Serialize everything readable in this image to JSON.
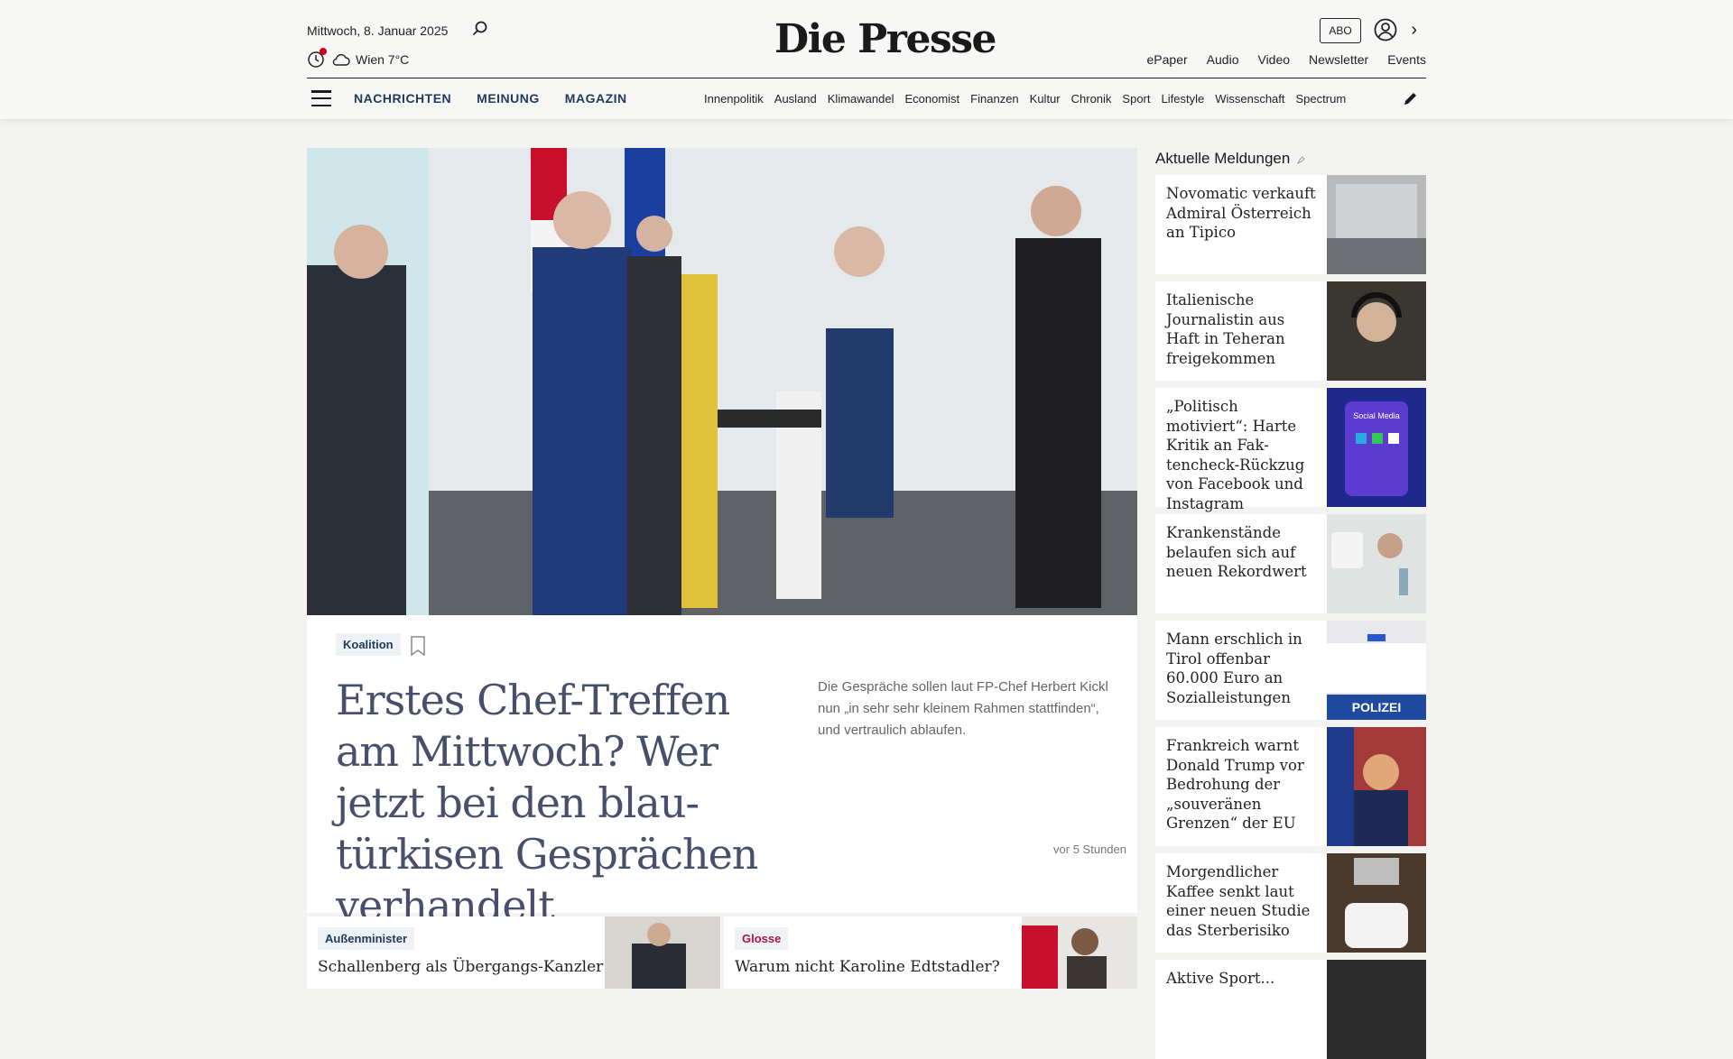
{
  "header": {
    "date": "Mittwoch, 8. Januar 2025",
    "weather": "Wien 7°C",
    "logo": "Die Presse",
    "abo_label": "ABO",
    "top_links": [
      "ePaper",
      "Audio",
      "Video",
      "Newsletter",
      "Events"
    ],
    "main_nav": [
      "NACHRICHTEN",
      "MEINUNG",
      "MAGAZIN"
    ],
    "sub_nav": [
      "Innenpolitik",
      "Ausland",
      "Klimawandel",
      "Economist",
      "Finanzen",
      "Kultur",
      "Chronik",
      "Sport",
      "Lifestyle",
      "Wissenschaft",
      "Spectrum"
    ]
  },
  "hero": {
    "tag": "Koalition",
    "title": "Erstes Chef-Treffen am Mittwoch? Wer jetzt bei den blau-türkisen Gesprächen verhandelt",
    "lead": "Die Gespräche sollen laut FP-Chef Herbert Kickl nun „in sehr sehr kleinem Rahmen stattfinden“, und vertraulich ablaufen.",
    "time": "vor 5 Stunden"
  },
  "cards": [
    {
      "tag": "Außenminister",
      "title": "Schallenberg als Übergangs-Kanzler fix"
    },
    {
      "tag": "Glosse",
      "title": "Warum nicht Karoline Edtstadler?"
    }
  ],
  "sidebar": {
    "heading": "Aktuelle Meldungen",
    "items": [
      "Novomatic verkauft Admiral Österreich an Tipico",
      "Italienische Journalistin aus Haft in Teheran freigekommen",
      "„Politisch motiviert“: Harte Kritik an Fak-tencheck-Rückzug von Facebook und Instagram",
      "Krankenstände belaufen sich auf neuen Rekordwert",
      "Mann erschlich in Tirol offenbar 60.000 Euro an Sozialleistungen",
      "Frankreich warnt Donald Trump vor Bedrohung der „souveränen Grenzen“ der EU",
      "Morgendlicher Kaffee senkt laut einer neuen Studie das Sterberisiko",
      "Aktive Sport..."
    ],
    "img_labels": {
      "social": "Social Media",
      "polizei": "POLIZEI"
    }
  },
  "colors": {
    "nav_blue": "#1f3a5c",
    "hero_title": "#46506b",
    "alert_red": "#d0021b",
    "glosse": "#b0144a"
  }
}
